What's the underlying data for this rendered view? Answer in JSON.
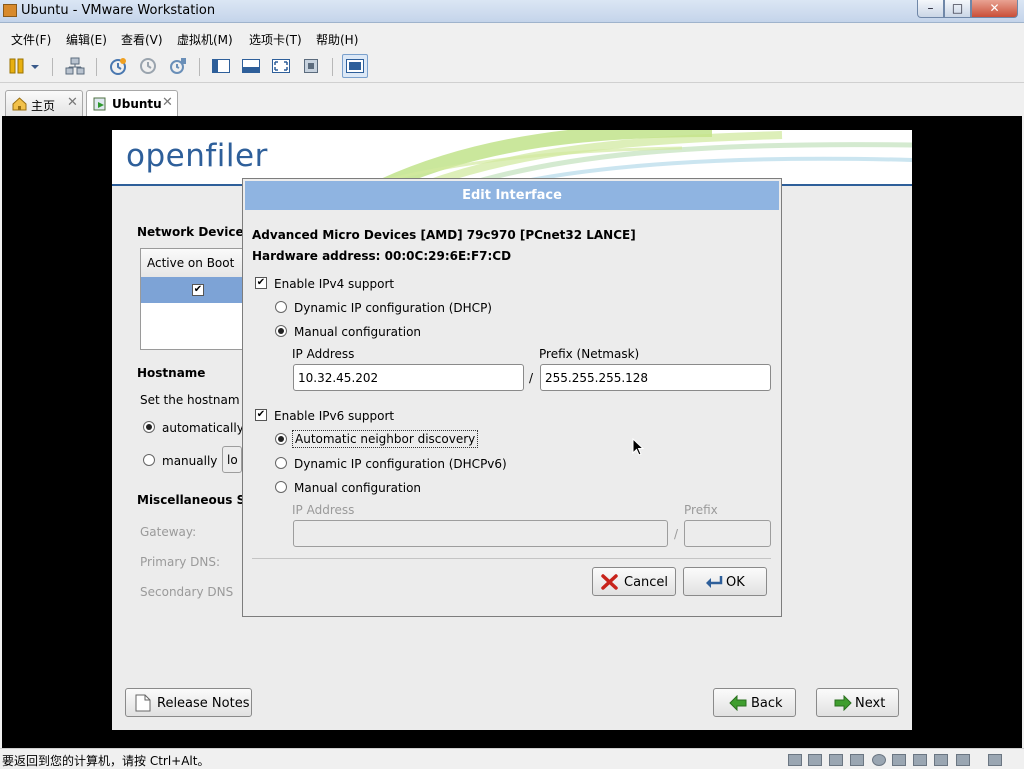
{
  "window": {
    "title": "Ubuntu - VMware Workstation",
    "min": "–",
    "max": "□",
    "close": "✕"
  },
  "menu": [
    "文件(F)",
    "编辑(E)",
    "查看(V)",
    "虚拟机(M)",
    "选项卡(T)",
    "帮助(H)"
  ],
  "tabs": [
    {
      "label": "主页",
      "close": "✕"
    },
    {
      "label": "Ubuntu",
      "close": "✕"
    }
  ],
  "installer": {
    "logo": "openfiler",
    "network_devices_heading": "Network Devices",
    "col_active_on_boot": "Active on Boot",
    "hostname_heading": "Hostname",
    "hostname_desc": "Set the hostnam",
    "hostname_auto": "automatically",
    "hostname_manual": "manually",
    "hostname_placeholder": "lo",
    "misc_heading": "Miscellaneous S",
    "gateway_label": "Gateway:",
    "primary_dns_label": "Primary DNS:",
    "secondary_dns_label": "Secondary DNS",
    "release_notes": "Release Notes",
    "back": "Back",
    "next": "Next"
  },
  "dialog": {
    "title": "Edit Interface",
    "device_name": "Advanced Micro Devices [AMD] 79c970 [PCnet32 LANCE]",
    "hardware_address": "Hardware address: 00:0C:29:6E:F7:CD",
    "ipv4_enable": "Enable IPv4 support",
    "ipv4_dhcp": "Dynamic IP configuration (DHCP)",
    "ipv4_manual": "Manual configuration",
    "ipv4_ip_label": "IP Address",
    "ipv4_prefix_label": "Prefix (Netmask)",
    "ipv4_ip_value": "10.32.45.202",
    "ipv4_prefix_value": "255.255.255.128",
    "slash": "/",
    "ipv6_enable": "Enable IPv6 support",
    "ipv6_auto": "Automatic neighbor discovery",
    "ipv6_dhcp": "Dynamic IP configuration (DHCPv6)",
    "ipv6_manual": "Manual configuration",
    "ipv6_ip_label": "IP Address",
    "ipv6_prefix_label": "Prefix",
    "cancel": "Cancel",
    "ok": "OK"
  },
  "status": {
    "message": "要返回到您的计算机，请按 Ctrl+Alt。"
  }
}
